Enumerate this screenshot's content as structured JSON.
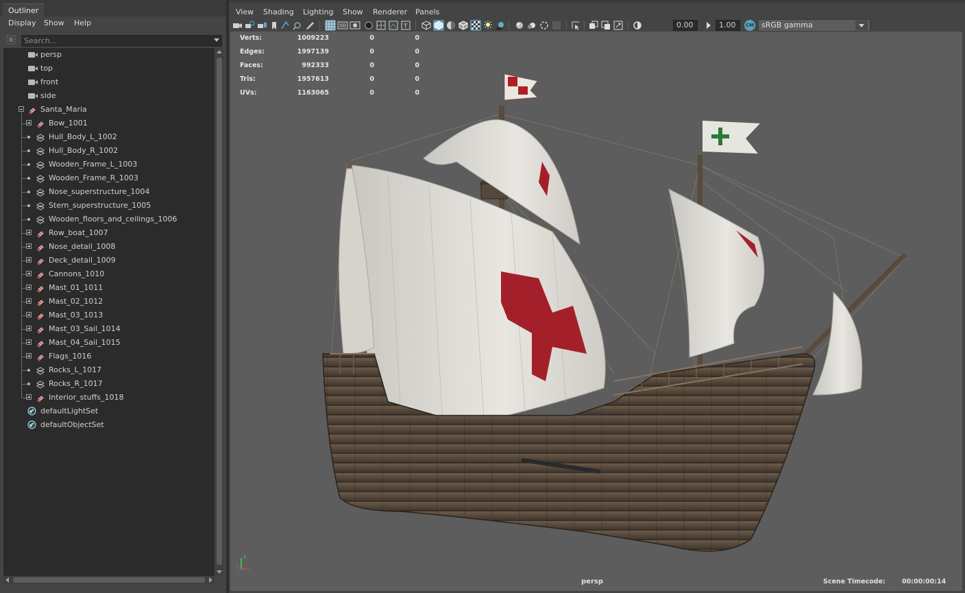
{
  "outliner": {
    "tab_label": "Outliner",
    "menu": [
      "Display",
      "Show",
      "Help"
    ],
    "search_placeholder": "Search...",
    "cameras": [
      "persp",
      "top",
      "front",
      "side"
    ],
    "root": "Santa_Maria",
    "children": [
      {
        "label": "Bow_1001",
        "type": "group"
      },
      {
        "label": "Hull_Body_L_1002",
        "type": "mesh"
      },
      {
        "label": "Hull_Body_R_1002",
        "type": "mesh"
      },
      {
        "label": "Wooden_Frame_L_1003",
        "type": "mesh"
      },
      {
        "label": "Wooden_Frame_R_1003",
        "type": "mesh"
      },
      {
        "label": "Nose_superstructure_1004",
        "type": "mesh"
      },
      {
        "label": "Stern_superstructure_1005",
        "type": "mesh"
      },
      {
        "label": "Wooden_floors_and_ceilings_1006",
        "type": "mesh"
      },
      {
        "label": "Row_boat_1007",
        "type": "group"
      },
      {
        "label": "Nose_detail_1008",
        "type": "group"
      },
      {
        "label": "Deck_detail_1009",
        "type": "group"
      },
      {
        "label": "Cannons_1010",
        "type": "group"
      },
      {
        "label": "Mast_01_1011",
        "type": "group"
      },
      {
        "label": "Mast_02_1012",
        "type": "group"
      },
      {
        "label": "Mast_03_1013",
        "type": "group"
      },
      {
        "label": "Mast_03_Sail_1014",
        "type": "group"
      },
      {
        "label": "Mast_04_Sail_1015",
        "type": "group"
      },
      {
        "label": "Flags_1016",
        "type": "group"
      },
      {
        "label": "Rocks_L_1017",
        "type": "mesh"
      },
      {
        "label": "Rocks_R_1017",
        "type": "mesh"
      },
      {
        "label": "Interior_stuffs_1018",
        "type": "group"
      }
    ],
    "sets": [
      "defaultLightSet",
      "defaultObjectSet"
    ]
  },
  "viewport": {
    "menu": [
      "View",
      "Shading",
      "Lighting",
      "Show",
      "Renderer",
      "Panels"
    ],
    "exposure": "0.00",
    "gamma": "1.00",
    "color_space": "sRGB gamma",
    "stats": [
      {
        "label": "Verts:",
        "v1": "1009223",
        "v2": "0",
        "v3": "0"
      },
      {
        "label": "Edges:",
        "v1": "1997139",
        "v2": "0",
        "v3": "0"
      },
      {
        "label": "Faces:",
        "v1": "992333",
        "v2": "0",
        "v3": "0"
      },
      {
        "label": "Tris:",
        "v1": "1957613",
        "v2": "0",
        "v3": "0"
      },
      {
        "label": "UVs:",
        "v1": "1163065",
        "v2": "0",
        "v3": "0"
      }
    ],
    "camera_name": "persp",
    "timecode_label": "Scene Timecode:",
    "timecode_value": "00:00:00:14",
    "axis_y": "Y",
    "axis_x": "X"
  }
}
